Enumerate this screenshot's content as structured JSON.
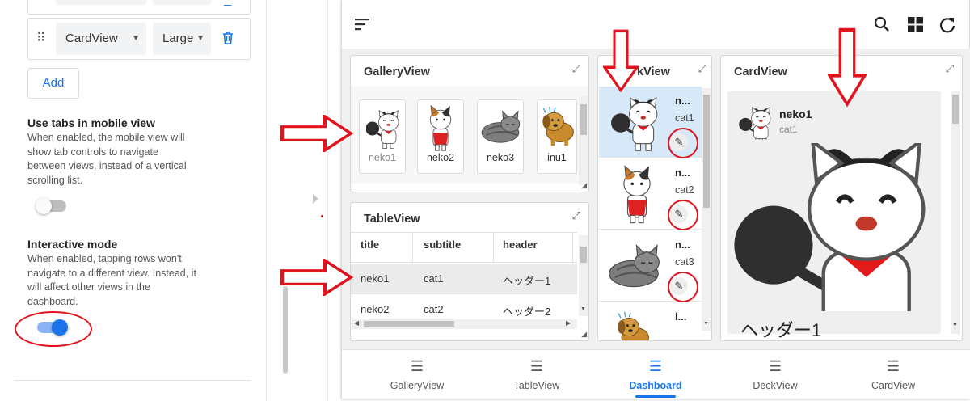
{
  "settings": {
    "row_sel_1": "CardView",
    "row_sel_2": "Large",
    "add_label": "Add",
    "tabs_title": "Use tabs in mobile view",
    "tabs_desc": "When enabled, the mobile view will show tab controls to navigate between views, instead of a vertical scrolling list.",
    "tabs_toggle_on": false,
    "interactive_title": "Interactive mode",
    "interactive_desc": "When enabled, tapping rows won't navigate to a different view. Instead, it will affect other views in the dashboard.",
    "interactive_toggle_on": true
  },
  "toolbar": {
    "menu_icon": "menu-icon",
    "search_icon": "search-icon",
    "grid_icon": "grid-icon",
    "refresh_icon": "refresh-icon"
  },
  "gallery": {
    "title": "GalleryView",
    "items": [
      "neko1",
      "neko2",
      "neko3",
      "inu1"
    ]
  },
  "table": {
    "title": "TableView",
    "columns": [
      "title",
      "subtitle",
      "header"
    ],
    "rows": [
      [
        "neko1",
        "cat1",
        "ヘッダー1"
      ],
      [
        "neko2",
        "cat2",
        "ヘッダー2"
      ]
    ]
  },
  "deck": {
    "title": "kView",
    "rows": [
      {
        "title": "n...",
        "subtitle": "cat1"
      },
      {
        "title": "n...",
        "subtitle": "cat2"
      },
      {
        "title": "n...",
        "subtitle": "cat3"
      },
      {
        "title": "i...",
        "subtitle": ""
      }
    ]
  },
  "cardview": {
    "title": "CardView",
    "item_title": "neko1",
    "item_subtitle": "cat1",
    "item_header": "ヘッダー1"
  },
  "tabs": [
    {
      "label": "GalleryView",
      "active": false
    },
    {
      "label": "TableView",
      "active": false
    },
    {
      "label": "Dashboard",
      "active": true
    },
    {
      "label": "DeckView",
      "active": false
    },
    {
      "label": "CardView",
      "active": false
    }
  ],
  "colors": {
    "accent": "#1a73e8",
    "annotation_red": "#e0141e",
    "selected_row": "#d7e8f8"
  }
}
